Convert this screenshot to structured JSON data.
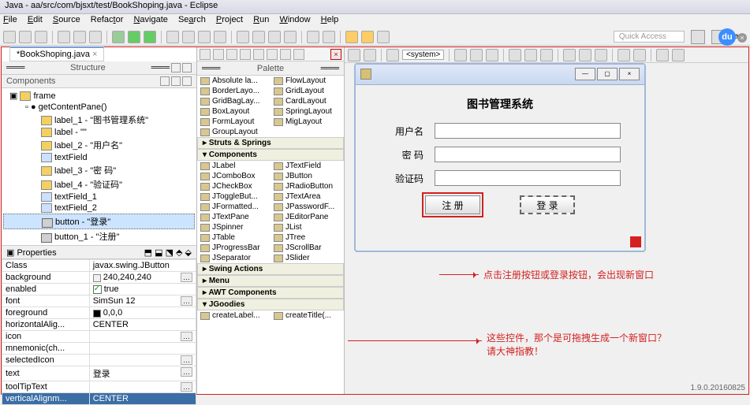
{
  "window": {
    "title": "Java - aa/src/com/bjsxt/test/BookShoping.java - Eclipse"
  },
  "menu": {
    "file": "File",
    "edit": "Edit",
    "source": "Source",
    "refactor": "Refactor",
    "navigate": "Navigate",
    "search": "Search",
    "project": "Project",
    "run": "Run",
    "window": "Window",
    "help": "Help"
  },
  "quick_access": "Quick Access",
  "java_persp": "Java",
  "editor_tab": "*BookShoping.java",
  "panes": {
    "structure": "Structure",
    "components": "Components",
    "properties": "Properties",
    "palette": "Palette"
  },
  "tree": {
    "frame": "frame",
    "method": "getContentPane()",
    "items": [
      "label_1 - \"图书管理系统\"",
      "label - \"\"",
      "label_2 - \"用户名\"",
      "textField",
      "label_3 - \"密  码\"",
      "label_4 - \"验证码\"",
      "textField_1",
      "textField_2",
      "button - \"登录\"",
      "button_1 - \"注册\""
    ]
  },
  "properties": [
    {
      "k": "Class",
      "v": "javax.swing.JButton"
    },
    {
      "k": "background",
      "v": "240,240,240"
    },
    {
      "k": "enabled",
      "v": "true"
    },
    {
      "k": "font",
      "v": "SimSun 12"
    },
    {
      "k": "foreground",
      "v": "0,0,0"
    },
    {
      "k": "horizontalAlig...",
      "v": "CENTER"
    },
    {
      "k": "icon",
      "v": ""
    },
    {
      "k": "mnemonic(ch...",
      "v": ""
    },
    {
      "k": "selectedIcon",
      "v": ""
    },
    {
      "k": "text",
      "v": "登录"
    },
    {
      "k": "toolTipText",
      "v": ""
    },
    {
      "k": "verticalAlignm...",
      "v": "CENTER"
    }
  ],
  "palette": {
    "layouts": [
      [
        "Absolute la...",
        "FlowLayout"
      ],
      [
        "BorderLayo...",
        "GridLayout"
      ],
      [
        "GridBagLay...",
        "CardLayout"
      ],
      [
        "BoxLayout",
        "SpringLayout"
      ],
      [
        "FormLayout",
        "MigLayout"
      ],
      [
        "GroupLayout",
        ""
      ]
    ],
    "struts": "Struts & Springs",
    "components_hdr": "Components",
    "components": [
      [
        "JLabel",
        "JTextField"
      ],
      [
        "JComboBox",
        "JButton"
      ],
      [
        "JCheckBox",
        "JRadioButton"
      ],
      [
        "JToggleBut...",
        "JTextArea"
      ],
      [
        "JFormatted...",
        "JPasswordF..."
      ],
      [
        "JTextPane",
        "JEditorPane"
      ],
      [
        "JSpinner",
        "JList"
      ],
      [
        "JTable",
        "JTree"
      ],
      [
        "JProgressBar",
        "JScrollBar"
      ],
      [
        "JSeparator",
        "JSlider"
      ]
    ],
    "swing_actions": "Swing Actions",
    "menu_hdr": "Menu",
    "awt": "AWT Components",
    "jgoodies": "JGoodies",
    "create": [
      "createLabel...",
      "createTitle(..."
    ]
  },
  "preview": {
    "title": "图书管理系统",
    "user_label": "用户名",
    "pass_label": "密  码",
    "captcha_label": "验证码",
    "register": "注  册",
    "login": "登  录"
  },
  "system_combo": "<system>",
  "annotations": {
    "a1": "点击注册按钮或登录按钮，会出现新窗口",
    "a2a": "这些控件，那个是可拖拽生成一个新窗口？",
    "a2b": "请大神指教！"
  },
  "baidu": "du",
  "version": "1.9.0.20160825"
}
